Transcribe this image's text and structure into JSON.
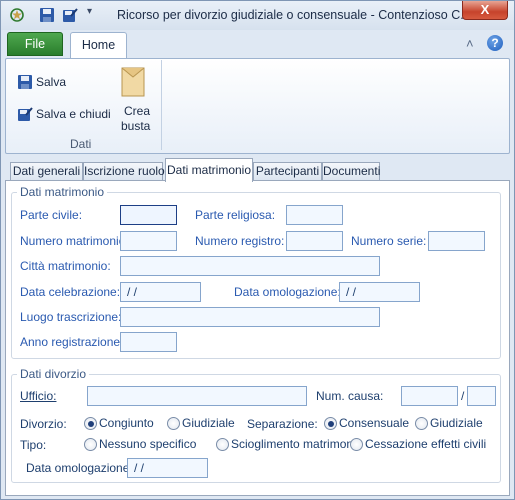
{
  "window": {
    "title": "Ricorso per divorzio giudiziale o consensuale - Contenzioso C...",
    "close_glyph": "X"
  },
  "ribbon": {
    "file_tab": "File",
    "home_tab": "Home",
    "collapse_glyph": "˄",
    "help_glyph": "?",
    "buttons": {
      "save": "Salva",
      "save_close": "Salva e chiudi",
      "create_folder_line1": "Crea",
      "create_folder_line2": "busta"
    },
    "group_label": "Dati"
  },
  "tabs": [
    "Dati generali",
    "Iscrizione ruolo",
    "Dati matrimonio",
    "Partecipanti",
    "Documenti"
  ],
  "matrimonio": {
    "legend": "Dati matrimonio",
    "parte_civile": "Parte civile:",
    "parte_religiosa": "Parte religiosa:",
    "numero_matrimonio": "Numero matrimonio:",
    "numero_registro": "Numero registro:",
    "numero_serie": "Numero serie:",
    "citta": "Città matrimonio:",
    "data_celebrazione": "Data celebrazione:",
    "data_celebrazione_value": " / /",
    "data_omologazione": "Data omologazione:",
    "data_omologazione_value": " / /",
    "luogo": "Luogo trascrizione:",
    "anno": "Anno registrazione:"
  },
  "divorzio": {
    "legend": "Dati divorzio",
    "ufficio": "Ufficio:",
    "num_causa": "Num. causa:",
    "slash": "/",
    "divorzio_label": "Divorzio:",
    "congiunto": "Congiunto",
    "giudiziale": "Giudiziale",
    "separazione_label": "Separazione:",
    "consensuale": "Consensuale",
    "giudiziale2": "Giudiziale",
    "tipo_label": "Tipo:",
    "nessuno": "Nessuno specifico",
    "scioglimento": "Scioglimento matrimonio",
    "cessazione": "Cessazione effetti civili",
    "data_omologazione": "Data omologazione:",
    "data_omologazione_value": " / /"
  },
  "colors": {
    "accent": "#2a5ab0",
    "file_tab": "#2a7d2c",
    "close": "#c7432c"
  }
}
